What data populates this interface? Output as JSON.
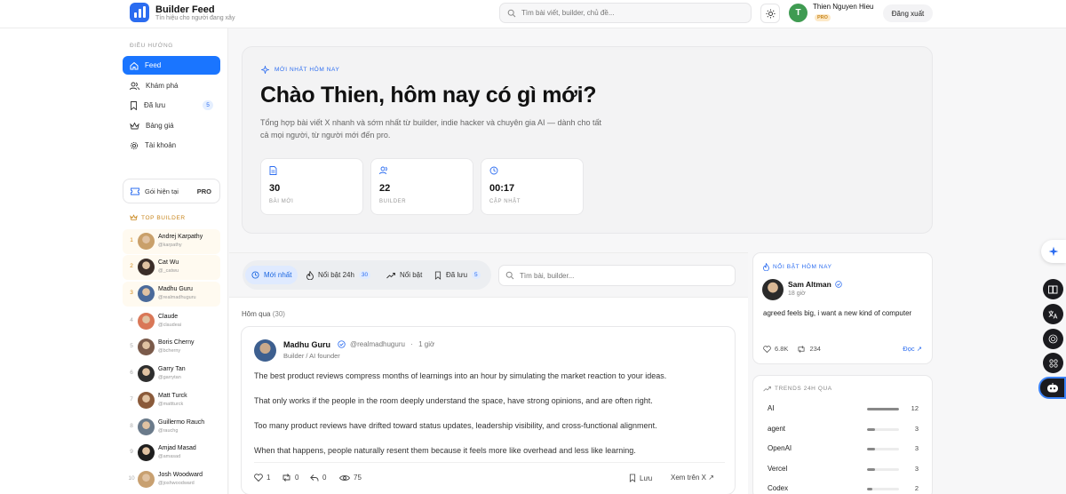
{
  "app": {
    "title": "Builder Feed",
    "tagline": "Tín hiệu cho người đang xây"
  },
  "topbar": {
    "search_placeholder": "Tìm bài viết, builder, chủ đề...",
    "user_initial": "T",
    "user_name": "Thien Nguyen Hieu",
    "user_badge": "PRO",
    "logout_label": "Đăng xuất"
  },
  "sidebar": {
    "section_label": "ĐIỀU HƯỚNG",
    "items": [
      {
        "label": "Feed",
        "icon": "home-icon"
      },
      {
        "label": "Khám phá",
        "icon": "users-icon"
      },
      {
        "label": "Đã lưu",
        "icon": "bookmark-icon",
        "badge": "5"
      },
      {
        "label": "Bảng giá",
        "icon": "crown-icon"
      },
      {
        "label": "Tài khoản",
        "icon": "gear-icon"
      }
    ],
    "plan_label": "Gói hiện tại",
    "plan_value": "PRO",
    "top_builder_label": "TOP BUILDER",
    "builders": [
      {
        "rank": "1",
        "name": "Andrej Karpathy",
        "handle": "@karpathy",
        "color": "#c9a06a"
      },
      {
        "rank": "2",
        "name": "Cat Wu",
        "handle": "@_catwu",
        "color": "#3a2d28"
      },
      {
        "rank": "3",
        "name": "Madhu Guru",
        "handle": "@realmadhuguru",
        "color": "#4a6a9a"
      },
      {
        "rank": "4",
        "name": "Claude",
        "handle": "@claudeai",
        "color": "#d97757"
      },
      {
        "rank": "5",
        "name": "Boris Cherny",
        "handle": "@bcherny",
        "color": "#7a5a4a"
      },
      {
        "rank": "6",
        "name": "Garry Tan",
        "handle": "@garrytan",
        "color": "#2e2e2e"
      },
      {
        "rank": "7",
        "name": "Matt Turck",
        "handle": "@mattturck",
        "color": "#8a5a3a"
      },
      {
        "rank": "8",
        "name": "Guillermo Rauch",
        "handle": "@rauchg",
        "color": "#6a7a8a"
      },
      {
        "rank": "9",
        "name": "Amjad Masad",
        "handle": "@amasad",
        "color": "#1e1e1e"
      },
      {
        "rank": "10",
        "name": "Josh Woodward",
        "handle": "@joshwoodward",
        "color": "#c8a070"
      }
    ]
  },
  "hero": {
    "tag": "MỚI NHẤT HÔM NAY",
    "title": "Chào Thien, hôm nay có gì mới?",
    "description": "Tổng hợp bài viết X nhanh và sớm nhất từ builder, indie hacker và chuyên gia AI — dành cho tất cả mọi người, từ người mới đến pro.",
    "stats": [
      {
        "value": "30",
        "label": "BÀI MỚI",
        "icon": "document-icon"
      },
      {
        "value": "22",
        "label": "BUILDER",
        "icon": "users-icon"
      },
      {
        "value": "00:17",
        "label": "CẬP NHẬT",
        "icon": "clock-icon"
      }
    ]
  },
  "feed": {
    "tabs": [
      {
        "label": "Mới nhất",
        "icon": "clock-icon"
      },
      {
        "label": "Nổi bật 24h",
        "icon": "flame-icon",
        "badge": "30"
      },
      {
        "label": "Nổi bật",
        "icon": "trend-icon"
      },
      {
        "label": "Đã lưu",
        "icon": "bookmark-icon",
        "badge": "5"
      }
    ],
    "search_placeholder": "Tìm bài, builder...",
    "group_title": "Hôm qua",
    "group_count": "(30)",
    "post": {
      "author": "Madhu Guru",
      "handle": "@realmadhuguru",
      "separator": "·",
      "time": "1 giờ",
      "role": "Builder / AI founder",
      "lines": [
        "The best product reviews compress months of learnings into an hour by simulating the market reaction to your ideas.",
        "That only works if the people in the room deeply understand the space, have strong opinions, and are often right.",
        "Too many product reviews have drifted toward status updates, leadership visibility, and cross-functional alignment.",
        "When that happens, people naturally resent them because it feels more like overhead and less like learning."
      ],
      "likes": "1",
      "reposts": "0",
      "replies": "0",
      "views": "75",
      "save_label": "Lưu",
      "view_on_x": "Xem trên X ↗"
    }
  },
  "highlight": {
    "label": "NỔI BẬT HÔM NAY",
    "author": "Sam Altman",
    "time": "18 giờ",
    "text": "agreed feels big, i want a new kind of computer",
    "likes": "6.8K",
    "reposts": "234",
    "read_label": "Đọc ↗"
  },
  "trends": {
    "label": "TRENDS 24H QUA",
    "items": [
      {
        "name": "AI",
        "count": "12",
        "fraction": 1.0
      },
      {
        "name": "agent",
        "count": "3",
        "fraction": 0.25
      },
      {
        "name": "OpenAI",
        "count": "3",
        "fraction": 0.25
      },
      {
        "name": "Vercel",
        "count": "3",
        "fraction": 0.25
      },
      {
        "name": "Codex",
        "count": "2",
        "fraction": 0.17
      }
    ]
  },
  "colors": {
    "accent": "#1a75ff",
    "pro_badge": "#c8861c",
    "avatar_green": "#3f9b52"
  }
}
